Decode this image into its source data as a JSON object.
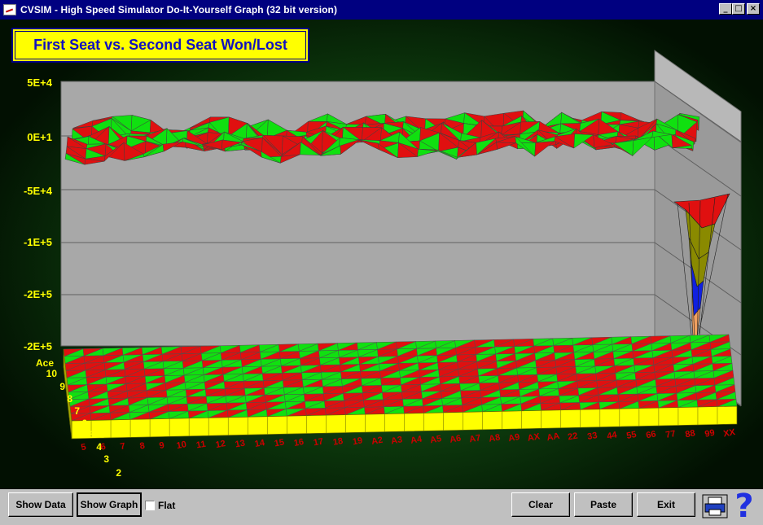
{
  "window": {
    "title": "CVSIM - High Speed Simulator Do-It-Yourself Graph (32 bit version)",
    "controls": [
      "_",
      "□",
      "×"
    ]
  },
  "chart_data": {
    "type": "surface-3d",
    "title": "First Seat vs. Second Seat Won/Lost",
    "z_tick_labels": [
      "5E+4",
      "0E+1",
      "-5E+4",
      "-1E+5",
      "-2E+5",
      "-2E+5"
    ],
    "y_tick_labels": [
      "Ace",
      "10",
      "9",
      "8",
      "7",
      "6",
      "5",
      "4",
      "3",
      "2"
    ],
    "x_tick_labels": [
      "5",
      "6",
      "7",
      "8",
      "9",
      "10",
      "11",
      "12",
      "13",
      "14",
      "15",
      "16",
      "17",
      "18",
      "19",
      "A2",
      "A3",
      "A4",
      "A5",
      "A6",
      "A7",
      "A8",
      "A9",
      "AX",
      "AA",
      "22",
      "33",
      "44",
      "55",
      "66",
      "77",
      "88",
      "99",
      "XX"
    ],
    "colors": {
      "surface_positive": "#e01010",
      "surface_negative": "#10e010",
      "wall": "#a8a8a8",
      "base_edge": "#ffff00",
      "axis_text": "#ffff00",
      "x_tick_text": "#cc0000",
      "drop_olive": "#8a8a00",
      "drop_blue": "#1020e0",
      "drop_orange": "#f0a060"
    }
  },
  "footer": {
    "show_data": "Show Data",
    "show_graph": "Show Graph",
    "flat_label": "Flat",
    "clear": "Clear",
    "paste": "Paste",
    "exit": "Exit"
  }
}
